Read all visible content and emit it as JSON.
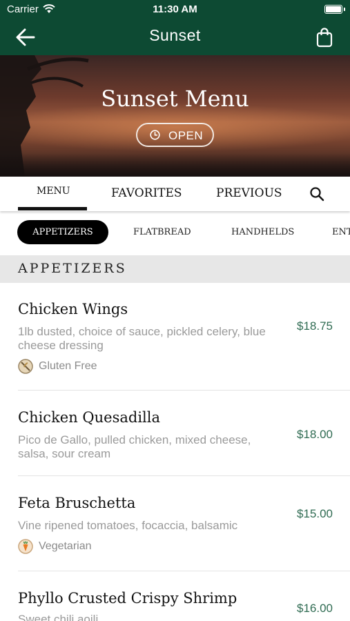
{
  "status_bar": {
    "carrier": "Carrier",
    "time": "11:30 AM"
  },
  "nav": {
    "title": "Sunset"
  },
  "hero": {
    "title": "Sunset Menu",
    "status": "OPEN"
  },
  "tabs": [
    {
      "label": "MENU",
      "active": true
    },
    {
      "label": "FAVORITES",
      "active": false
    },
    {
      "label": "PREVIOUS",
      "active": false
    }
  ],
  "chips": [
    {
      "label": "APPETIZERS",
      "active": true
    },
    {
      "label": "FLATBREAD",
      "active": false
    },
    {
      "label": "HANDHELDS",
      "active": false
    },
    {
      "label": "ENTREES",
      "active": false
    }
  ],
  "section": {
    "title": "APPETIZERS"
  },
  "items": [
    {
      "name": "Chicken Wings",
      "description": "1lb dusted, choice of sauce, pickled celery, blue cheese dressing",
      "price": "$18.75",
      "tag": "Gluten Free",
      "tag_icon": "gluten-free-icon"
    },
    {
      "name": "Chicken Quesadilla",
      "description": "Pico de Gallo, pulled chicken, mixed cheese, salsa, sour cream",
      "price": "$18.00"
    },
    {
      "name": "Feta Bruschetta",
      "description": "Vine ripened tomatoes, focaccia, balsamic",
      "price": "$15.00",
      "tag": "Vegetarian",
      "tag_icon": "carrot-icon"
    },
    {
      "name": "Phyllo Crusted Crispy Shrimp",
      "description": "Sweet chili aoili",
      "price": "$16.00"
    }
  ],
  "colors": {
    "brand_green": "#0d4a33",
    "price_green": "#2f6b52",
    "tag_tan": "#e6d6b8",
    "carrot": "#e87b22"
  }
}
